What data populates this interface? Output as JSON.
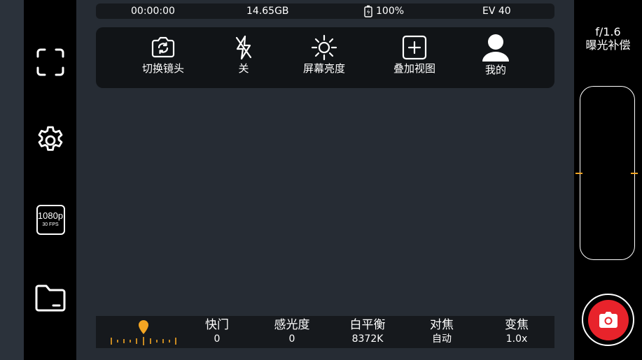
{
  "status": {
    "timer": "00:00:00",
    "storage": "14.65GB",
    "battery": "100%",
    "ev": "EV 40"
  },
  "toolbar": {
    "switch_camera": "切换镜头",
    "flash": "关",
    "brightness": "屏幕亮度",
    "overlay": "叠加视图",
    "profile": "我的"
  },
  "sidebar": {
    "resolution": "1080p",
    "fps": "30 FPS"
  },
  "controls": {
    "shutter_label": "快门",
    "shutter_value": "0",
    "iso_label": "感光度",
    "iso_value": "0",
    "wb_label": "白平衡",
    "wb_value": "8372K",
    "focus_label": "对焦",
    "focus_value": "自动",
    "zoom_label": "变焦",
    "zoom_value": "1.0x"
  },
  "right_panel": {
    "aperture": "f/1.6",
    "exposure_comp": "曝光补偿",
    "exposure_level": 0.5
  },
  "colors": {
    "accent": "#f5a623",
    "shutter": "#e8232b",
    "background": "#262c34"
  },
  "icons": [
    "frame-icon",
    "gear-icon",
    "folder-icon",
    "camera-switch-icon",
    "flash-off-icon",
    "brightness-icon",
    "plus-square-icon",
    "user-icon",
    "battery-icon",
    "camera-icon",
    "location-pin-icon"
  ]
}
